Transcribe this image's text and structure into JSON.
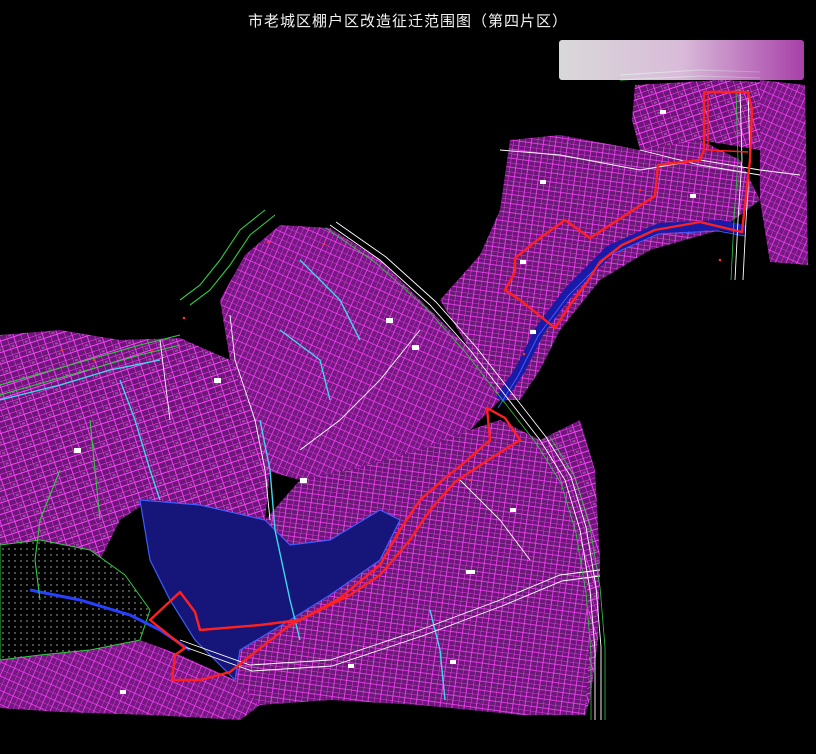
{
  "map": {
    "title": "市老城区棚户区改造征迁范围图（第四片区）",
    "colors": {
      "background": "#000000",
      "parcels": "#ff33ff",
      "parcel_fill": "#7a1f86",
      "roads": "#ffffff",
      "water": "#1a1aa8",
      "water_edge": "#3d5cff",
      "green_lines": "#2ecc40",
      "cyan_lines": "#3fd8e8",
      "boundary": "#ff2020"
    },
    "road_label_main": "",
    "road_label_river": ""
  }
}
